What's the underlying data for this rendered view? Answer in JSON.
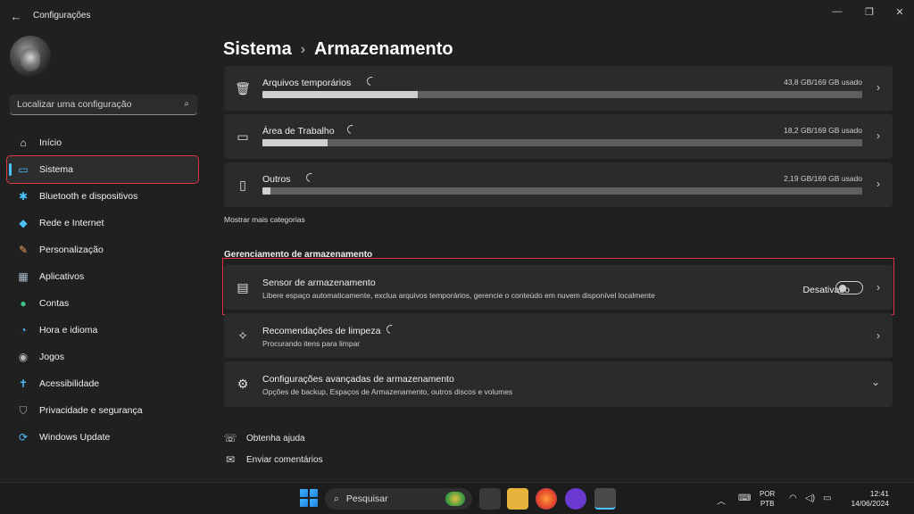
{
  "window": {
    "title": "Configurações",
    "back_icon": "←",
    "minimize_icon": "—",
    "maximize_icon": "❐",
    "close_icon": "✕"
  },
  "search": {
    "placeholder": "Localizar uma configuração",
    "icon": "⌕"
  },
  "sidebar": {
    "items": [
      {
        "label": "Início",
        "icon": "⌂",
        "color": "#e8e8e8"
      },
      {
        "label": "Sistema",
        "icon": "▭",
        "color": "#4cc2ff"
      },
      {
        "label": "Bluetooth e dispositivos",
        "icon": "✱",
        "color": "#4cc2ff"
      },
      {
        "label": "Rede e Internet",
        "icon": "◆",
        "color": "#4cc2ff"
      },
      {
        "label": "Personalização",
        "icon": "✎",
        "color": "#e8a35c"
      },
      {
        "label": "Aplicativos",
        "icon": "▦",
        "color": "#a8b8c8"
      },
      {
        "label": "Contas",
        "icon": "●",
        "color": "#3fc98a"
      },
      {
        "label": "Hora e idioma",
        "icon": "◔",
        "color": "#4cc2ff"
      },
      {
        "label": "Jogos",
        "icon": "◉",
        "color": "#b8b8b8"
      },
      {
        "label": "Acessibilidade",
        "icon": "✝",
        "color": "#4cc2ff"
      },
      {
        "label": "Privacidade e segurança",
        "icon": "⛉",
        "color": "#a8a8a8"
      },
      {
        "label": "Windows Update",
        "icon": "⟳",
        "color": "#4cc2ff"
      }
    ]
  },
  "header": {
    "section": "Sistema",
    "separator": "›",
    "page": "Armazenamento"
  },
  "storage": {
    "categories": [
      {
        "name": "Arquivos temporários",
        "usage": "43,8 GB/169 GB usado",
        "icon": "🗑",
        "fraction": 0.259
      },
      {
        "name": "Área de Trabalho",
        "usage": "18,2 GB/169 GB usado",
        "icon": "▭",
        "fraction": 0.108
      },
      {
        "name": "Outros",
        "usage": "2,19 GB/169 GB usado",
        "icon": "▯",
        "fraction": 0.013
      }
    ],
    "show_more": "Mostrar mais categorias",
    "chevron": "›"
  },
  "management": {
    "section_title": "Gerenciamento de armazenamento",
    "sensor": {
      "title": "Sensor de armazenamento",
      "subtitle": "Libere espaço automaticamente, exclua arquivos temporários, gerencie o conteúdo em nuvem disponível localmente",
      "toggle_label": "Desativado",
      "toggle_on": false,
      "icon": "▤"
    },
    "cleanup": {
      "title": "Recomendações de limpeza",
      "subtitle": "Procurando itens para limpar",
      "icon": "✧"
    },
    "advanced": {
      "title": "Configurações avançadas de armazenamento",
      "subtitle": "Opções de backup, Espaços de Armazenamento, outros discos e volumes",
      "icon": "⚙",
      "expand_icon": "⌄"
    }
  },
  "help": {
    "get_help": "Obtenha ajuda",
    "get_help_icon": "☏",
    "feedback": "Enviar comentários",
    "feedback_icon": "✉"
  },
  "taskbar": {
    "search_label": "Pesquisar",
    "search_icon": "⌕",
    "language_top": "POR",
    "language_bottom": "PTB",
    "time": "12:41",
    "date": "14/06/2024",
    "tray_up_icon": "︿",
    "keyboard_icon": "⌨",
    "wifi_icon": "◠",
    "volume_icon": "◁)",
    "battery_icon": "▭"
  }
}
